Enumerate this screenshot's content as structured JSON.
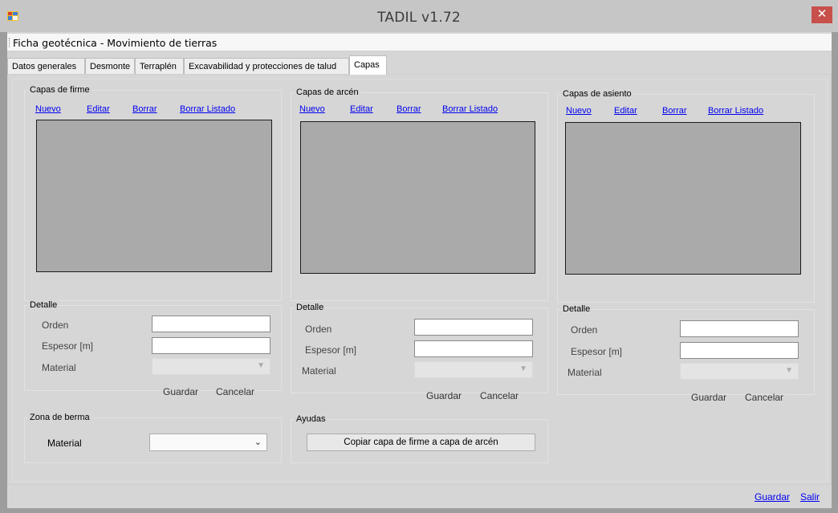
{
  "window": {
    "title": "TADIL v1.72",
    "close_glyph": "✕"
  },
  "menu": {
    "item": "Ficha geotécnica - Movimiento de tierras"
  },
  "tabs": [
    {
      "label": "Datos generales"
    },
    {
      "label": "Desmonte"
    },
    {
      "label": "Terraplén"
    },
    {
      "label": "Excavabilidad y protecciones de talud"
    },
    {
      "label": "Capas"
    }
  ],
  "active_tab": "Capas",
  "groups": [
    {
      "title": "Capas de firme",
      "links": {
        "nuevo": "Nuevo",
        "editar": "Editar",
        "borrar": "Borrar",
        "borrar_listado": "Borrar Listado"
      },
      "detalle": {
        "title": "Detalle",
        "orden_label": "Orden",
        "orden_value": "",
        "espesor_label": "Espesor [m]",
        "espesor_value": "",
        "material_label": "Material",
        "material_value": "",
        "guardar": "Guardar",
        "cancelar": "Cancelar"
      }
    },
    {
      "title": "Capas de arcén",
      "links": {
        "nuevo": "Nuevo",
        "editar": "Editar",
        "borrar": "Borrar",
        "borrar_listado": "Borrar Listado"
      },
      "detalle": {
        "title": "Detalle",
        "orden_label": "Orden",
        "orden_value": "",
        "espesor_label": "Espesor [m]",
        "espesor_value": "",
        "material_label": "Material",
        "material_value": "",
        "guardar": "Guardar",
        "cancelar": "Cancelar"
      }
    },
    {
      "title": "Capas de asiento",
      "links": {
        "nuevo": "Nuevo",
        "editar": "Editar",
        "borrar": "Borrar",
        "borrar_listado": "Borrar Listado"
      },
      "detalle": {
        "title": "Detalle",
        "orden_label": "Orden",
        "orden_value": "",
        "espesor_label": "Espesor [m]",
        "espesor_value": "",
        "material_label": "Material",
        "material_value": "",
        "guardar": "Guardar",
        "cancelar": "Cancelar"
      }
    }
  ],
  "zona_berma": {
    "title": "Zona de berma",
    "material_label": "Material",
    "material_value": ""
  },
  "ayudas": {
    "title": "Ayudas",
    "button": "Copiar capa de firme a capa de arcén"
  },
  "footer": {
    "guardar": "Guardar",
    "salir": "Salir"
  },
  "icons": {
    "app": "app-window-icon",
    "close": "close-icon",
    "dropdown": "chevron-down-icon"
  },
  "colors": {
    "link": "#0000ee",
    "close_button": "#c7504b",
    "list_background": "#aaaaaa"
  }
}
